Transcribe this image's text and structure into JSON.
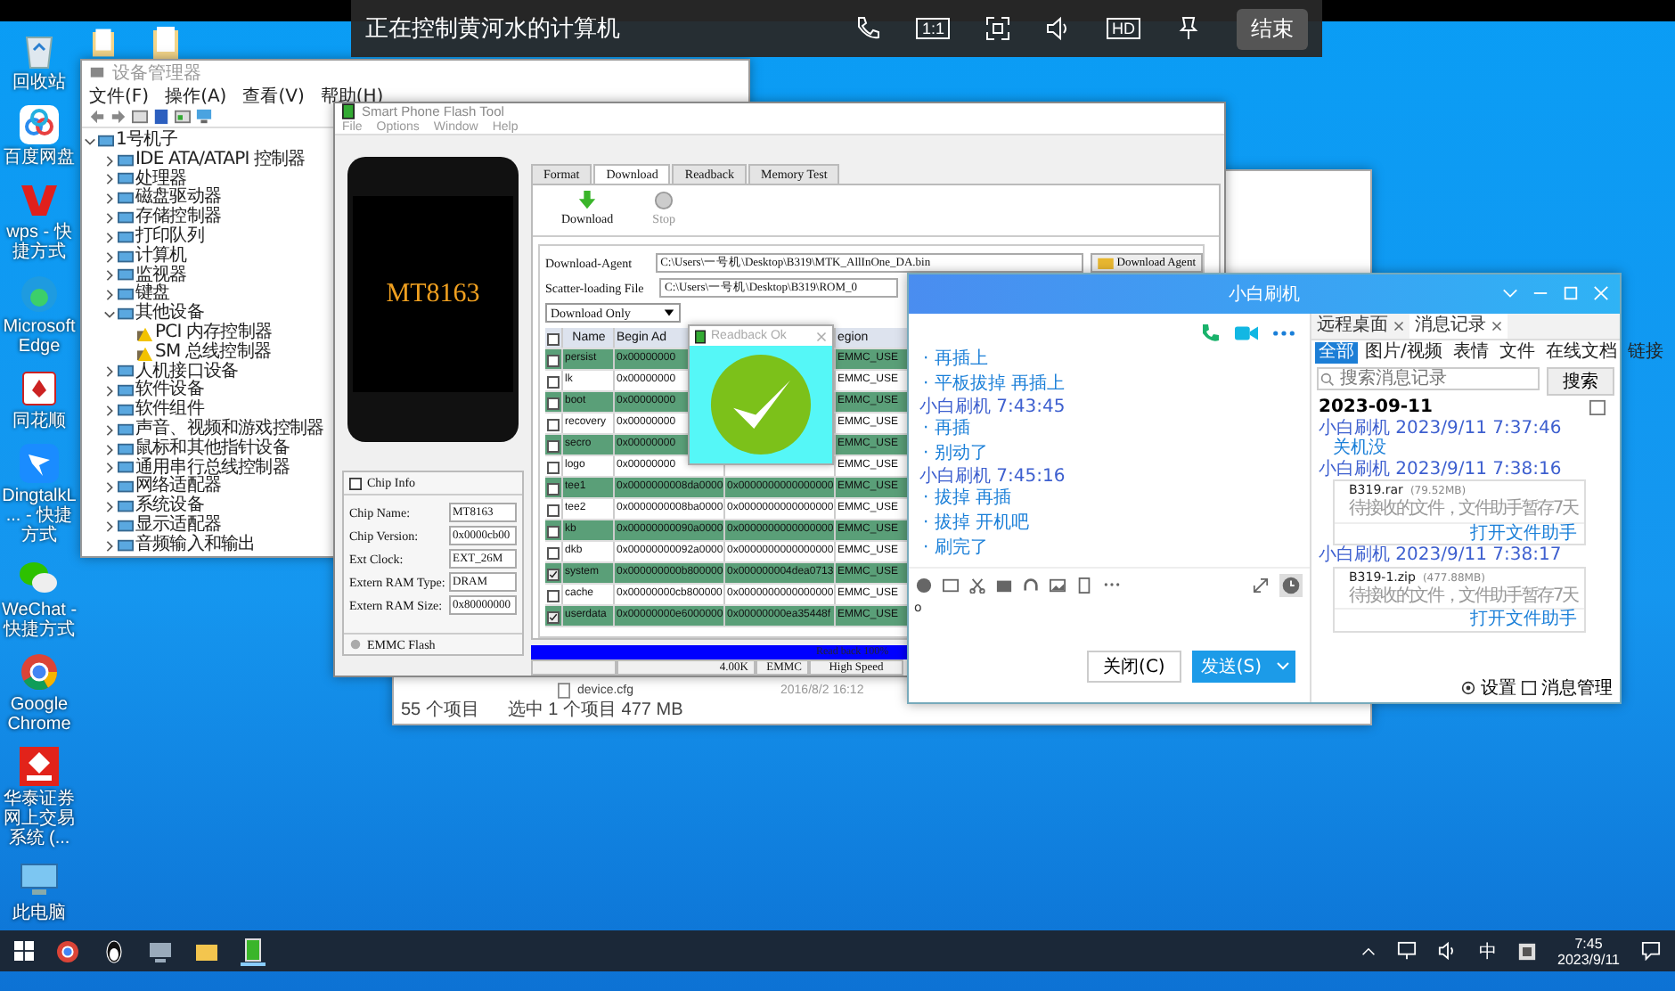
{
  "remote_bar": {
    "title": "正在控制黄河水的计算机",
    "ratio": "1:1",
    "quality": "HD",
    "end_button": "结束"
  },
  "desktop_icons": [
    {
      "kind": "recycle",
      "label": "回收站"
    },
    {
      "kind": "cloud",
      "label": "百度网盘"
    },
    {
      "kind": "wps",
      "label": "wps - 快捷方式"
    },
    {
      "kind": "edge",
      "label": "Microsoft Edge"
    },
    {
      "kind": "cards",
      "label": "同花顺"
    },
    {
      "kind": "dingtalk",
      "label": "DingtalkL... - 快捷方式"
    },
    {
      "kind": "wechat",
      "label": "WeChat - 快捷方式"
    },
    {
      "kind": "chrome",
      "label": "Google Chrome"
    },
    {
      "kind": "securities",
      "label": "华泰证券网上交易系统 (..."
    },
    {
      "kind": "computer",
      "label": "此电脑"
    }
  ],
  "device_manager": {
    "title": "设备管理器",
    "menu": [
      "文件(F)",
      "操作(A)",
      "查看(V)",
      "帮助(H)"
    ],
    "tree": [
      {
        "label": "1号机子",
        "expanded": true,
        "children": [
          {
            "label": "IDE ATA/ATAPI 控制器",
            "expanded": false
          },
          {
            "label": "处理器",
            "expanded": false
          },
          {
            "label": "磁盘驱动器",
            "expanded": false
          },
          {
            "label": "存储控制器",
            "expanded": false
          },
          {
            "label": "打印队列",
            "expanded": false
          },
          {
            "label": "计算机",
            "expanded": false
          },
          {
            "label": "监视器",
            "expanded": false
          },
          {
            "label": "键盘",
            "expanded": false
          },
          {
            "label": "其他设备",
            "expanded": true,
            "children": [
              {
                "label": "PCI 内存控制器",
                "warning": true
              },
              {
                "label": "SM 总线控制器",
                "warning": true
              }
            ]
          },
          {
            "label": "人机接口设备",
            "expanded": false
          },
          {
            "label": "软件设备",
            "expanded": false
          },
          {
            "label": "软件组件",
            "expanded": false
          },
          {
            "label": "声音、视频和游戏控制器",
            "expanded": false
          },
          {
            "label": "鼠标和其他指针设备",
            "expanded": false
          },
          {
            "label": "通用串行总线控制器",
            "expanded": false
          },
          {
            "label": "网络适配器",
            "expanded": false
          },
          {
            "label": "系统设备",
            "expanded": false
          },
          {
            "label": "显示适配器",
            "expanded": false
          },
          {
            "label": "音频输入和输出",
            "expanded": false
          }
        ]
      }
    ]
  },
  "explorer": {
    "file_name": "device.cfg",
    "file_date": "2016/8/2 16:12",
    "item_count": "55 个项目",
    "selection": "选中 1 个项目  477 MB"
  },
  "flash_tool": {
    "title": "Smart Phone Flash Tool",
    "menu": [
      "File",
      "Options",
      "Window",
      "Help"
    ],
    "phone_label": "MT8163",
    "chip_info": {
      "title": "Chip Info",
      "fields": [
        {
          "label": "Chip Name:",
          "value": "MT8163"
        },
        {
          "label": "Chip Version:",
          "value": "0x0000cb00"
        },
        {
          "label": "Ext Clock:",
          "value": "EXT_26M"
        },
        {
          "label": "Extern RAM Type:",
          "value": "DRAM"
        },
        {
          "label": "Extern RAM Size:",
          "value": "0x80000000"
        }
      ],
      "storage": "EMMC Flash"
    },
    "tabs": [
      {
        "label": "Format",
        "selected": false
      },
      {
        "label": "Download",
        "selected": true
      },
      {
        "label": "Readback",
        "selected": false
      },
      {
        "label": "Memory Test",
        "selected": false
      }
    ],
    "actions": [
      {
        "kind": "download",
        "label": "Download",
        "disabled": false
      },
      {
        "kind": "stop",
        "label": "Stop",
        "disabled": true
      }
    ],
    "download_agent": {
      "label": "Download-Agent",
      "value": "C:\\Users\\一号机\\Desktop\\B319\\MTK_AllInOne_DA.bin",
      "button": "Download Agent"
    },
    "scatter_file": {
      "label": "Scatter-loading File",
      "value": "C:\\Users\\一号机\\Desktop\\B319\\ROM_0"
    },
    "mode": "Download Only",
    "table": {
      "all_checked": false,
      "columns": [
        "Name",
        "Begin Ad",
        "egion"
      ],
      "rows": [
        {
          "name": "persist",
          "checked": false,
          "begin": "0x00000000",
          "region": "EMMC_USE"
        },
        {
          "name": "lk",
          "checked": false,
          "begin": "0x00000000",
          "region": "EMMC_USE"
        },
        {
          "name": "boot",
          "checked": false,
          "begin": "0x00000000",
          "region": "EMMC_USE"
        },
        {
          "name": "recovery",
          "checked": false,
          "begin": "0x00000000",
          "region": "EMMC_USE"
        },
        {
          "name": "secro",
          "checked": false,
          "begin": "0x00000000",
          "region": "EMMC_USE"
        },
        {
          "name": "logo",
          "checked": false,
          "begin": "0x00000000",
          "region": "EMMC_USE"
        },
        {
          "name": "tee1",
          "checked": false,
          "begin": "0x0000000008da0000",
          "end": "0x0000000000000000",
          "region": "EMMC_USE"
        },
        {
          "name": "tee2",
          "checked": false,
          "begin": "0x0000000008ba0000",
          "end": "0x0000000000000000",
          "region": "EMMC_USE"
        },
        {
          "name": "kb",
          "checked": false,
          "begin": "0x00000000090a0000",
          "end": "0x0000000000000000",
          "region": "EMMC_USE"
        },
        {
          "name": "dkb",
          "checked": false,
          "begin": "0x00000000092a0000",
          "end": "0x0000000000000000",
          "region": "EMMC_USE"
        },
        {
          "name": "system",
          "checked": true,
          "begin": "0x000000000b800000",
          "end": "0x000000004dea0713",
          "region": "EMMC_USE"
        },
        {
          "name": "cache",
          "checked": false,
          "begin": "0x00000000cb800000",
          "end": "0x0000000000000000",
          "region": "EMMC_USE"
        },
        {
          "name": "userdata",
          "checked": true,
          "begin": "0x00000000e6000000",
          "end": "0x00000000ea35448f",
          "region": "EMMC_USE"
        }
      ]
    },
    "progress": {
      "label": "Read back 100%",
      "level": 1
    },
    "status": [
      "4.00K",
      "EMMC",
      "High Speed"
    ]
  },
  "readback_dialog": {
    "title": "Readback Ok"
  },
  "chat": {
    "title": "小白刷机",
    "messages": [
      {
        "kind": "message",
        "text": "· 再插上"
      },
      {
        "kind": "message",
        "text": "· 平板拔掉 再插上"
      },
      {
        "kind": "sender",
        "text": "小白刷机  7:43:45"
      },
      {
        "kind": "message",
        "text": "· 再插"
      },
      {
        "kind": "message",
        "text": "· 别动了"
      },
      {
        "kind": "sender",
        "text": "小白刷机  7:45:16"
      },
      {
        "kind": "message",
        "text": "· 拔掉 再插"
      },
      {
        "kind": "message",
        "text": "· 拔掉 开机吧"
      },
      {
        "kind": "message",
        "text": "· 刷完了"
      }
    ],
    "input_value": "o",
    "close_button": "关闭(C)",
    "send_button": "发送(S)",
    "panel_tabs": [
      {
        "label": "远程桌面",
        "selected": false
      },
      {
        "label": "消息记录",
        "selected": true
      }
    ],
    "filters": [
      {
        "label": "全部",
        "selected": true
      },
      {
        "label": "图片/视频",
        "selected": false
      },
      {
        "label": "表情",
        "selected": false
      },
      {
        "label": "文件",
        "selected": false
      },
      {
        "label": "在线文档",
        "selected": false
      },
      {
        "label": "链接",
        "selected": false
      }
    ],
    "search_placeholder": "搜索消息记录",
    "search_button": "搜索",
    "history": [
      {
        "kind": "date",
        "text": "2023-09-11"
      },
      {
        "kind": "sender",
        "text": "小白刷机 2023/9/11 7:37:46"
      },
      {
        "kind": "message",
        "text": "关机没"
      },
      {
        "kind": "sender",
        "text": "小白刷机 2023/9/11 7:38:16"
      },
      {
        "kind": "file",
        "name": "B319.rar",
        "size": "(79.52MB)",
        "note": "待接收的文件，文件助手暂存7天",
        "link": "打开文件助手"
      },
      {
        "kind": "sender",
        "text": "小白刷机 2023/9/11 7:38:17"
      },
      {
        "kind": "file",
        "name": "B319-1.zip",
        "size": "(477.88MB)",
        "note": "待接收的文件，文件助手暂存7天",
        "link": "打开文件助手"
      }
    ],
    "footer": [
      "设置",
      "消息管理"
    ]
  },
  "taskbar": {
    "ime": "中",
    "time": "7:45",
    "date": "2023/9/11"
  }
}
